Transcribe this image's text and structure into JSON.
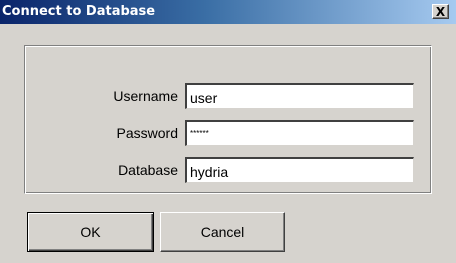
{
  "window": {
    "title": "Connect to Database",
    "close_glyph": "X",
    "close_icon": "close-icon"
  },
  "form": {
    "username": {
      "label": "Username",
      "value": "user"
    },
    "password": {
      "label": "Password",
      "value": "******"
    },
    "database": {
      "label": "Database",
      "value": "hydria"
    }
  },
  "buttons": {
    "ok_label": "OK",
    "cancel_label": "Cancel"
  },
  "colors": {
    "dialog_face": "#d6d3ce",
    "titlebar_start": "#0a246a",
    "titlebar_end": "#a6caf0"
  }
}
